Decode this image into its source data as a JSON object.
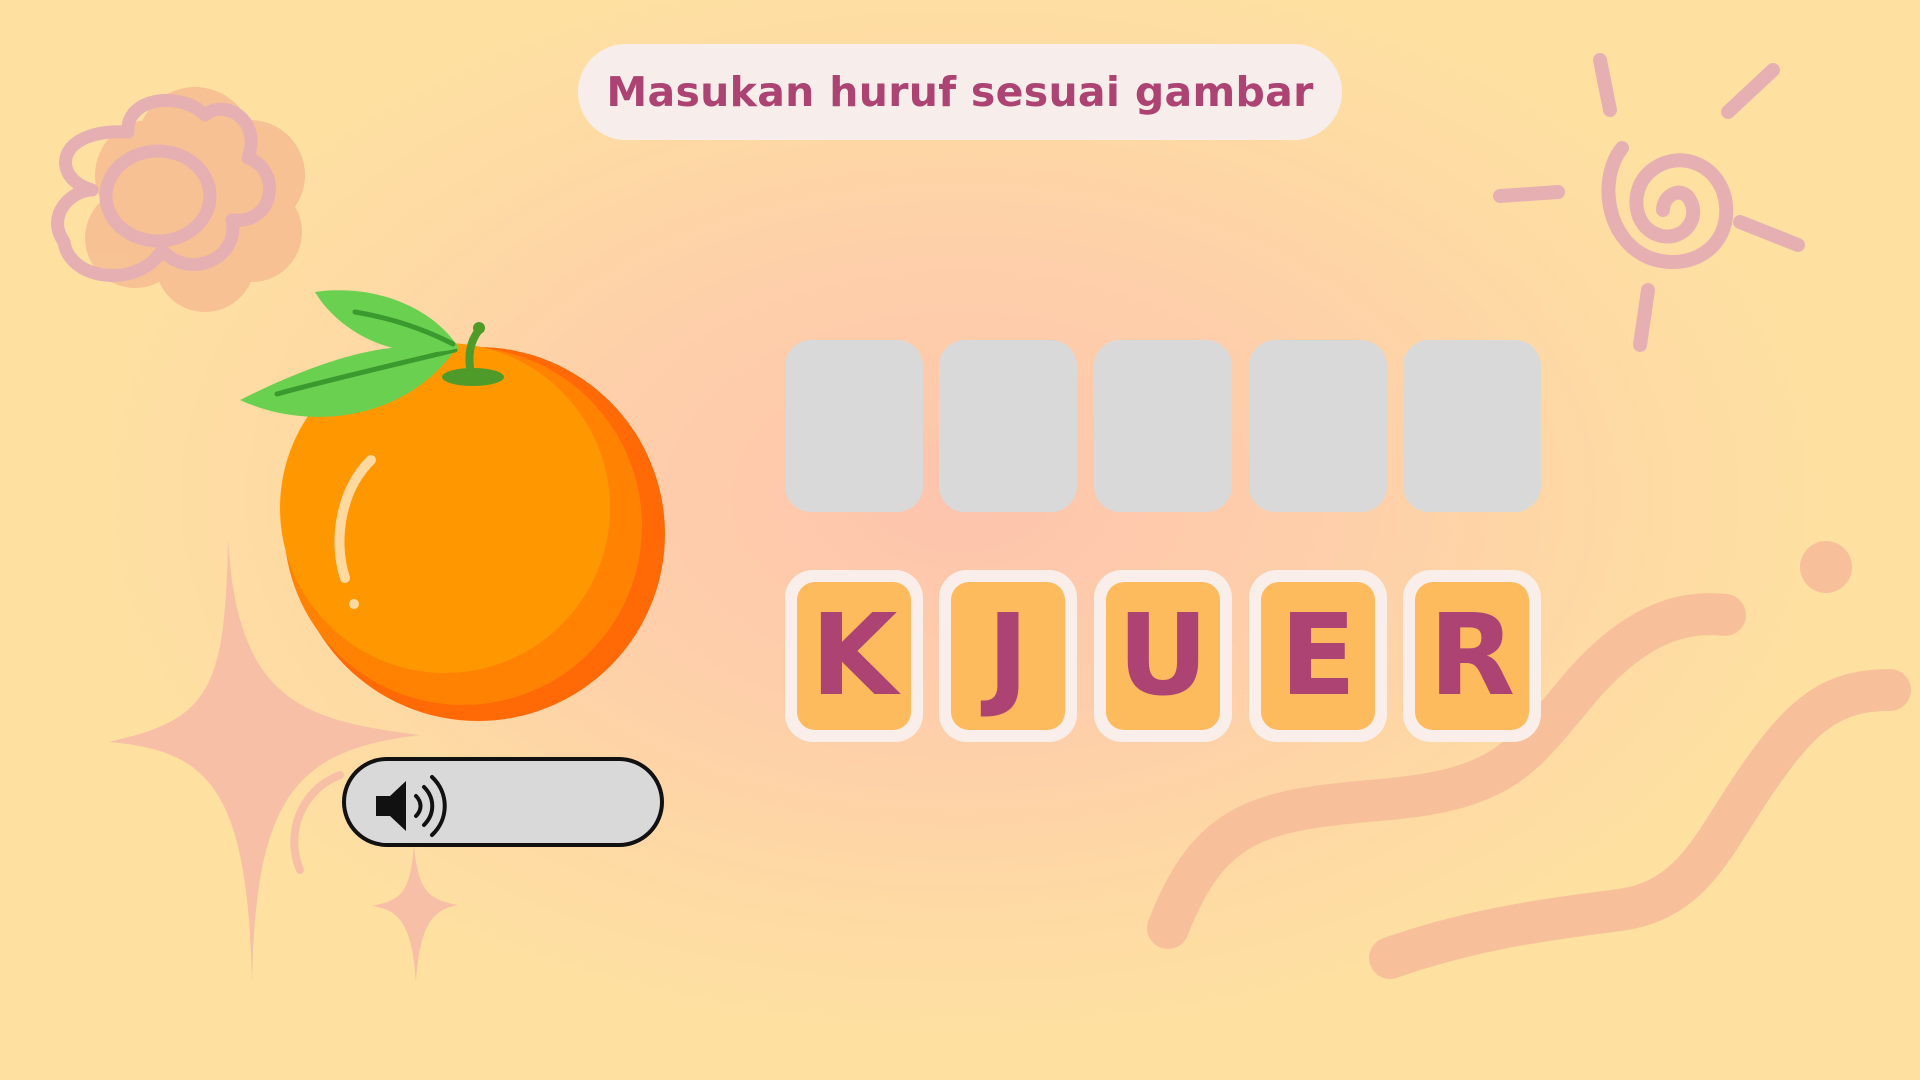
{
  "instruction": {
    "text": "Masukan huruf sesuai gambar"
  },
  "picture": {
    "icon": "orange-fruit-icon"
  },
  "audio": {
    "icon": "speaker-icon"
  },
  "answer_slots": [
    "",
    "",
    "",
    "",
    ""
  ],
  "letter_tiles": [
    "K",
    "J",
    "U",
    "E",
    "R"
  ],
  "colors": {
    "accent_text": "#ac4372",
    "tile_face": "#fdbb5e",
    "tile_border": "#faeeea",
    "slot_empty": "#d9d9d9",
    "pill_background": "#f7eeec"
  }
}
